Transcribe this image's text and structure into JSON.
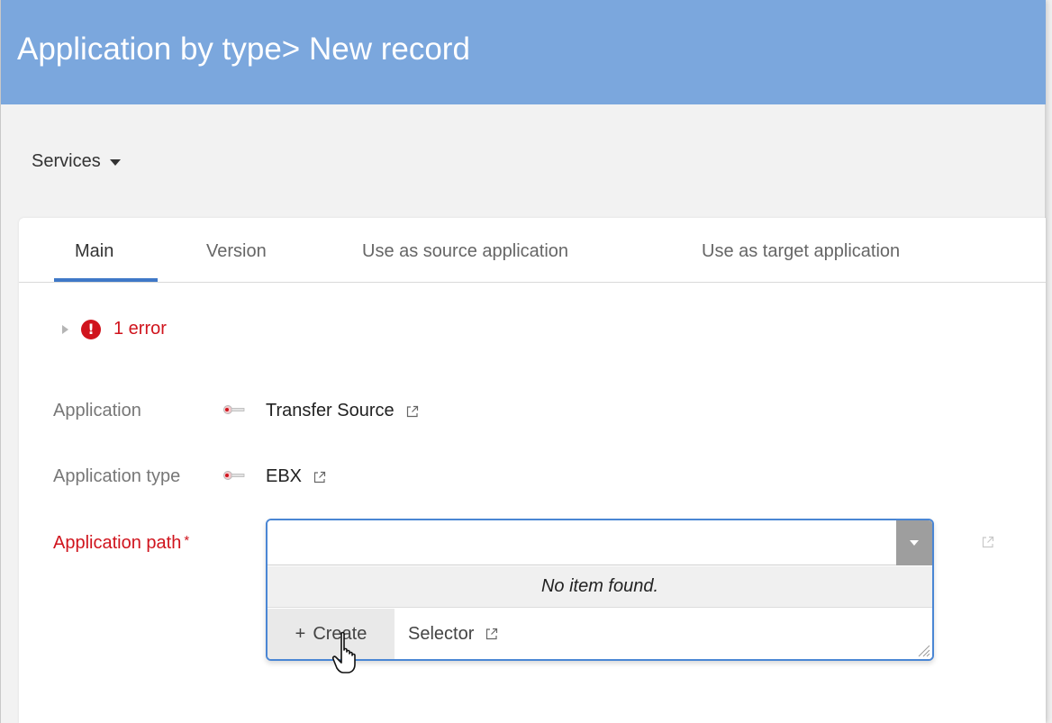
{
  "header": {
    "title": "Application by type> New record"
  },
  "services": {
    "label": "Services"
  },
  "tabs": [
    {
      "label": "Main",
      "active": true
    },
    {
      "label": "Version",
      "active": false
    },
    {
      "label": "Use as source application",
      "active": false
    },
    {
      "label": "Use as target application",
      "active": false
    }
  ],
  "errors": {
    "text": "1 error",
    "icon": "exclamation-icon"
  },
  "fields": {
    "application": {
      "label": "Application",
      "value": "Transfer Source"
    },
    "application_type": {
      "label": "Application type",
      "value": "EBX"
    },
    "application_path": {
      "label": "Application path",
      "required_mark": "*",
      "value": "",
      "no_item_text": "No item found.",
      "create_label": "Create",
      "selector_label": "Selector"
    }
  },
  "colors": {
    "header_bg": "#7ba7dd",
    "accent": "#3f78c7",
    "error": "#d0141d"
  }
}
